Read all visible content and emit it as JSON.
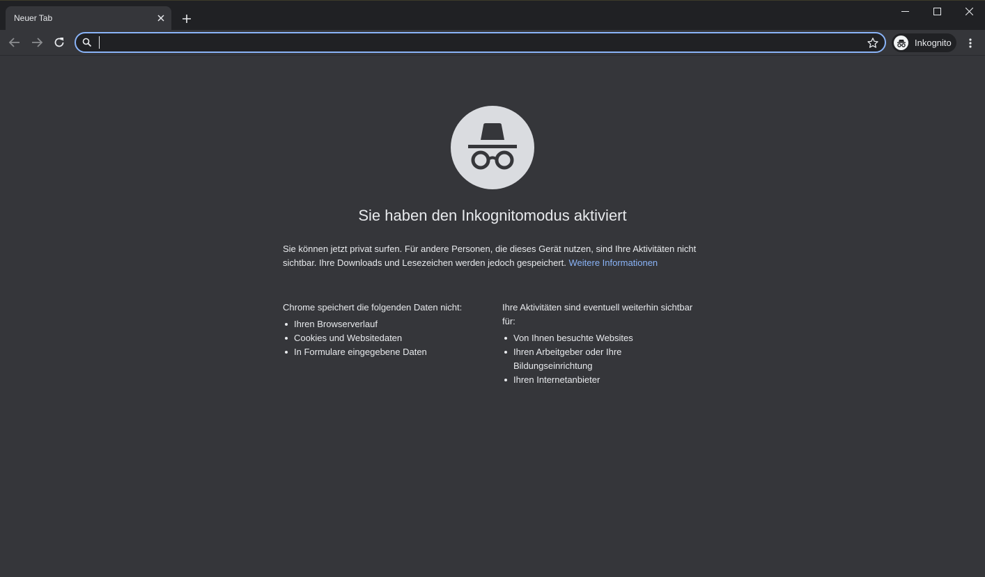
{
  "tab": {
    "title": "Neuer Tab"
  },
  "omnibox": {
    "value": "",
    "placeholder": ""
  },
  "profile": {
    "label": "Inkognito"
  },
  "page": {
    "heading": "Sie haben den Inkognitomodus aktiviert",
    "intro_text": "Sie können jetzt privat surfen. Für andere Personen, die dieses Gerät nutzen, sind Ihre Aktivitäten nicht sichtbar. Ihre Downloads und Lesezeichen werden jedoch gespeichert.",
    "learn_more": "Weitere Informationen",
    "left_column": {
      "heading": "Chrome speichert die folgenden Daten nicht:",
      "items": [
        "Ihren Browserverlauf",
        "Cookies und Websitedaten",
        "In Formulare eingegebene Daten"
      ]
    },
    "right_column": {
      "heading": "Ihre Aktivitäten sind eventuell weiterhin sichtbar für:",
      "items": [
        "Von Ihnen besuchte Websites",
        "Ihren Arbeitgeber oder Ihre Bildungseinrichtung",
        "Ihren Internetanbieter"
      ]
    }
  },
  "colors": {
    "frame": "#202124",
    "page_background": "#35363a",
    "link": "#8ab4f8",
    "focus_ring": "#8ab4f8",
    "icon_circle": "#dadce0"
  }
}
